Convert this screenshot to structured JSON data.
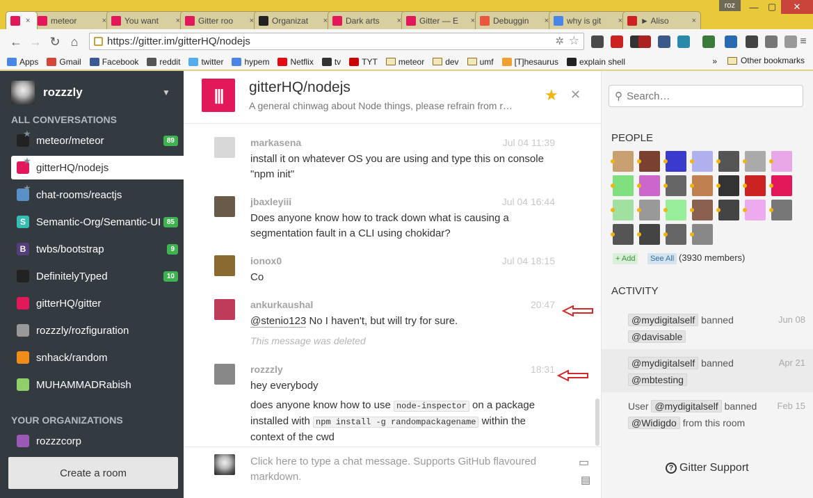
{
  "browser": {
    "user_badge": "roz",
    "tabs": [
      {
        "title": "",
        "color": "#e2185a"
      },
      {
        "title": "meteor",
        "color": "#e2185a"
      },
      {
        "title": "You want",
        "color": "#e2185a"
      },
      {
        "title": "Gitter roo",
        "color": "#e2185a"
      },
      {
        "title": "Organizat",
        "color": "#222222"
      },
      {
        "title": "Dark arts",
        "color": "#e2185a"
      },
      {
        "title": "Gitter — E",
        "color": "#e2185a"
      },
      {
        "title": "Debuggin",
        "color": "#e9573f"
      },
      {
        "title": "why is git",
        "color": "#4a86e8"
      },
      {
        "title": "► Aliso",
        "color": "#cc2222"
      }
    ],
    "url": "https://gitter.im/gitterHQ/nodejs",
    "bookmarks": [
      {
        "label": "Apps",
        "color": "#4a86e8"
      },
      {
        "label": "Gmail",
        "color": "#d44638"
      },
      {
        "label": "Facebook",
        "color": "#3b5998"
      },
      {
        "label": "reddit",
        "color": "#555555"
      },
      {
        "label": "twitter",
        "color": "#55acee"
      },
      {
        "label": "hypem",
        "color": "#4a86e8"
      },
      {
        "label": "Netflix",
        "color": "#e50914"
      },
      {
        "label": "tv",
        "color": "#333333"
      },
      {
        "label": "TYT",
        "color": "#cc0000"
      },
      {
        "label": "meteor",
        "color": "folder"
      },
      {
        "label": "dev",
        "color": "folder"
      },
      {
        "label": "umf",
        "color": "folder"
      },
      {
        "label": "[T]hesaurus",
        "color": "#f0a030"
      },
      {
        "label": "explain shell",
        "color": "#222222"
      }
    ],
    "bookmarks_more": "»",
    "other_bookmarks": "Other bookmarks"
  },
  "sidebar": {
    "username": "rozzzly",
    "all_conversations_label": "ALL CONVERSATIONS",
    "rooms": [
      {
        "name": "meteor/meteor",
        "badge": "89",
        "icon_color": "#222222",
        "icon_text": ""
      },
      {
        "name": "gitterHQ/nodejs",
        "badge": "",
        "icon_color": "#e2185a",
        "icon_text": ""
      },
      {
        "name": "chat-rooms/reactjs",
        "badge": "",
        "icon_color": "#5a8fc8",
        "icon_text": ""
      },
      {
        "name": "Semantic-Org/Semantic-UI",
        "badge": "85",
        "icon_color": "#35bdb2",
        "icon_text": "S"
      },
      {
        "name": "twbs/bootstrap",
        "badge": "9",
        "icon_color": "#563d7c",
        "icon_text": "B"
      },
      {
        "name": "DefinitelyTyped",
        "badge": "10",
        "icon_color": "#222222",
        "icon_text": ""
      },
      {
        "name": "gitterHQ/gitter",
        "badge": "",
        "icon_color": "#e2185a",
        "icon_text": ""
      },
      {
        "name": "rozzzly/rozfiguration",
        "badge": "",
        "icon_color": "#999999",
        "icon_text": ""
      },
      {
        "name": "snhack/random",
        "badge": "",
        "icon_color": "#f08c1a",
        "icon_text": ""
      },
      {
        "name": "MUHAMMADRabish",
        "badge": "",
        "icon_color": "#8fd06a",
        "icon_text": ""
      }
    ],
    "your_organizations_label": "YOUR ORGANIZATIONS",
    "organizations": [
      {
        "name": "rozzzcorp",
        "icon_color": "#9b59b6"
      }
    ],
    "create_room_label": "Create a room"
  },
  "header": {
    "room_name": "gitterHQ/nodejs",
    "topic": "A general chinwag about Node things, please refrain from r…"
  },
  "messages": [
    {
      "user": "markasena",
      "time": "Jul 04 11:39",
      "text": "install it on whatever OS you are using and type this on console \"npm init\"",
      "avatar_color": "#d8d8d8"
    },
    {
      "user": "jbaxleyiii",
      "time": "Jul 04 16:44",
      "text": "Does anyone know how to track down what is causing a segmentation fault in a CLI using chokidar?",
      "avatar_color": "#6a5a4a"
    },
    {
      "user": "ionox0",
      "time": "Jul 04 18:15",
      "text": "Co",
      "avatar_color": "#8a6a30"
    },
    {
      "user": "ankurkaushal",
      "time": "20:47",
      "mention": "@stenio123",
      "text": " No I haven't, but will try for sure.",
      "deleted": "This message was deleted",
      "avatar_color": "#c03a5a"
    },
    {
      "user": "rozzzly",
      "time": "18:31",
      "text": "hey everybody",
      "text2_parts": [
        "does anyone know how to use ",
        "node-inspector",
        " on a package installed with ",
        "npm install -g randompackagename",
        " within the context of the cwd"
      ],
      "avatar_color": "#888888"
    }
  ],
  "input": {
    "placeholder": "Click here to type a chat message. Supports GitHub flavoured markdown."
  },
  "right": {
    "search_placeholder": "Search…",
    "people_label": "PEOPLE",
    "people_colors": [
      "#c9a070",
      "#7a4030",
      "#3a3acc",
      "#b0b0ee",
      "#555555",
      "#aaaaaa",
      "#e8a8e8",
      "#80e080",
      "#cc66cc",
      "#666666",
      "#c08050",
      "#333333",
      "#cc2222",
      "#e2185a",
      "#a0e0a0",
      "#999999",
      "#99ee99",
      "#8a6050",
      "#444444",
      "#eeaaee",
      "#777777",
      "#555555",
      "#444444",
      "#666666",
      "#888888"
    ],
    "add_label": "+ Add",
    "see_all_label": "See All",
    "members_count": "(3930 members)",
    "activity_label": "ACTIVITY",
    "activity": [
      {
        "prefix": "",
        "actor": "@mydigitalself",
        "verb": "banned",
        "target": "@davisable",
        "suffix": "",
        "date": "Jun 08"
      },
      {
        "prefix": "",
        "actor": "@mydigitalself",
        "verb": "banned",
        "target": "@mbtesting",
        "suffix": "",
        "date": "Apr 21"
      },
      {
        "prefix": "User",
        "actor": "@mydigitalself",
        "verb": "banned",
        "target": "@Widigdo",
        "suffix": "from this room",
        "date": "Feb 15"
      }
    ],
    "support_label": "Gitter Support"
  },
  "colors": {
    "sidebar_bg": "#333a40",
    "brand": "#e2185a",
    "badge_green": "#3fb34f",
    "star": "#f1b40f"
  }
}
